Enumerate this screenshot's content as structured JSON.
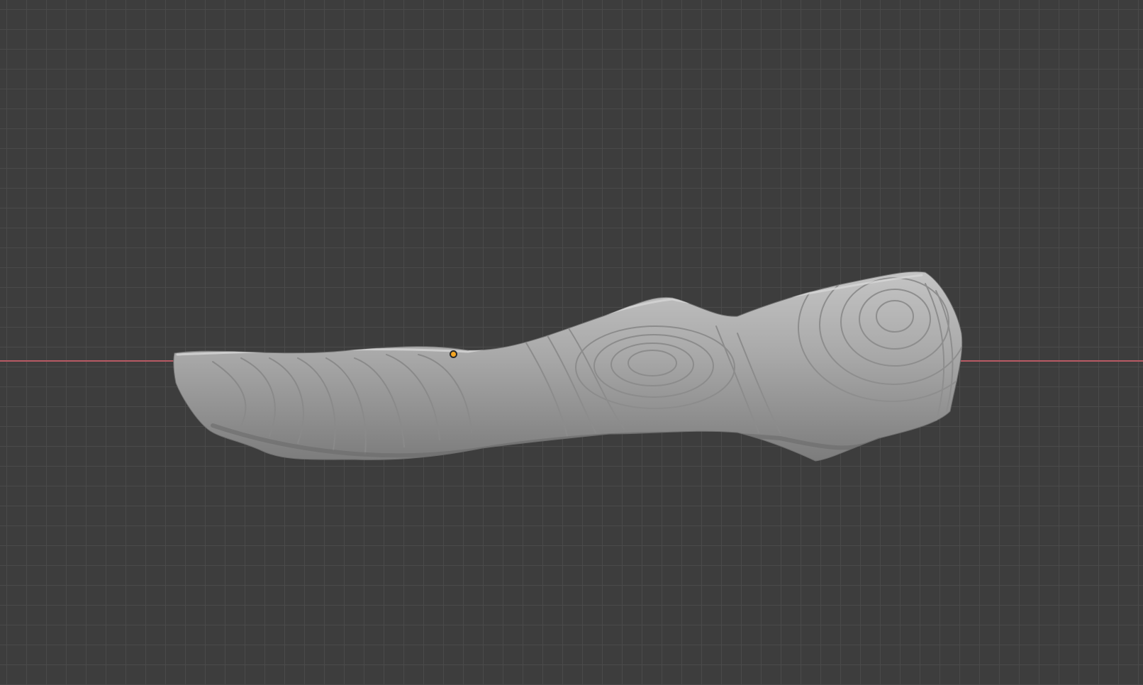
{
  "viewport": {
    "background_color": "#3d3d3d",
    "grid_color": "#4a4a4a",
    "x_axis_color": "#b85a64"
  },
  "object": {
    "kind": "sculpted-mesh",
    "surface_color": "#a9a9a9",
    "origin_color": "#f5a623"
  }
}
